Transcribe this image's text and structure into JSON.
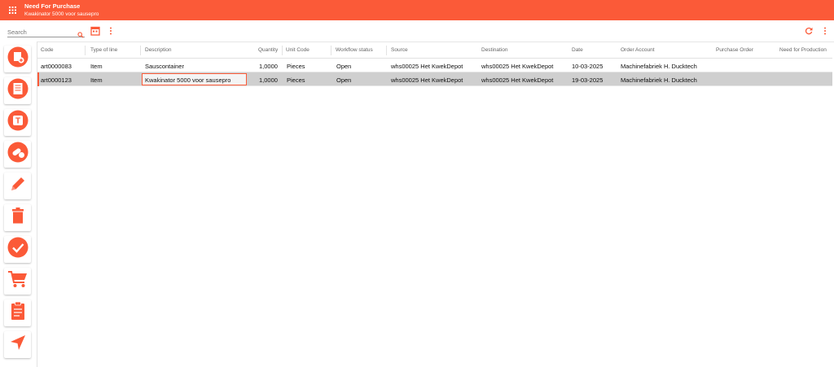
{
  "header": {
    "title": "Need For Purchase",
    "subtitle": "Kwakinator 5000 voor sausepro",
    "bg_color": "#fb5a38"
  },
  "toolbar": {
    "search_placeholder": "Search",
    "icons": [
      "search-icon",
      "calendar-icon",
      "more-vert-icon",
      "refresh-icon",
      "more-vert-icon"
    ]
  },
  "sidebar": {
    "buttons": [
      "add-document-icon",
      "document-list-icon",
      "text-badge-icon",
      "pills-icon",
      "pencil-icon",
      "trash-icon",
      "check-circle-icon",
      "cart-icon",
      "clipboard-icon",
      "send-icon"
    ]
  },
  "table": {
    "columns": [
      "Code",
      "Type of line",
      "Description",
      "Quantity",
      "Unit Code",
      "Workflow status",
      "Source",
      "Destination",
      "Date",
      "Order Account",
      "Purchase Order",
      "Need for Production"
    ],
    "rows": [
      {
        "code": "art0000083",
        "type": "Item",
        "description": "Sauscontainer",
        "quantity": "1,0000",
        "unit": "Pieces",
        "status": "Open",
        "source": "whs00025 Het KwekDepot",
        "destination": "whs00025 Het KwekDepot",
        "date": "10-03-2025",
        "account": "Machinefabriek H. Ducktech",
        "purchase_order": "",
        "need_for_production": ""
      },
      {
        "code": "art0000123",
        "type": "Item",
        "description": "Kwakinator 5000 voor sausepro",
        "quantity": "1,0000",
        "unit": "Pieces",
        "status": "Open",
        "source": "whs00025 Het KwekDepot",
        "destination": "whs00025 Het KwekDepot",
        "date": "19-03-2025",
        "account": "Machinefabriek H. Ducktech",
        "purchase_order": "",
        "need_for_production": ""
      }
    ]
  },
  "accent_color": "#fb5a38"
}
